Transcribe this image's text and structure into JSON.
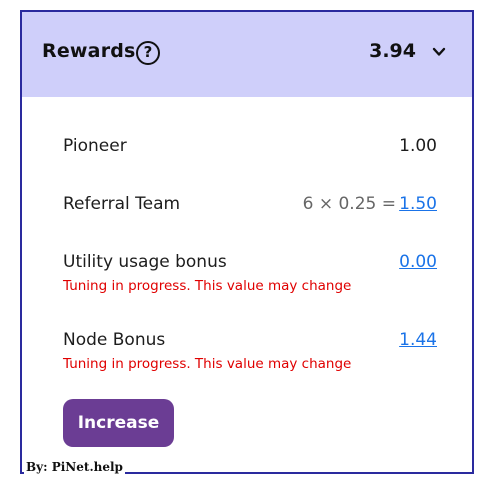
{
  "header": {
    "title": "Rewards",
    "help_icon_glyph": "?",
    "total": "3.94",
    "expand_icon": "chevron-down-icon"
  },
  "rewards": {
    "pioneer": {
      "label": "Pioneer",
      "value": "1.00"
    },
    "referral_team": {
      "label": "Referral Team",
      "calculation": "6 × 0.25 =",
      "value": "1.50"
    },
    "utility_usage_bonus": {
      "label": "Utility usage bonus",
      "value": "0.00",
      "note": "Tuning in progress. This value may change"
    },
    "node_bonus": {
      "label": "Node Bonus",
      "value": "1.44",
      "note": "Tuning in progress. This value may change"
    }
  },
  "actions": {
    "increase_label": "Increase"
  },
  "watermark": "By: PiNet.help",
  "colors": {
    "header_bg": "#cfcffa",
    "frame_border": "#2a2a9e",
    "link": "#1a73e8",
    "warning": "#e00000",
    "button": "#6b3d94"
  }
}
